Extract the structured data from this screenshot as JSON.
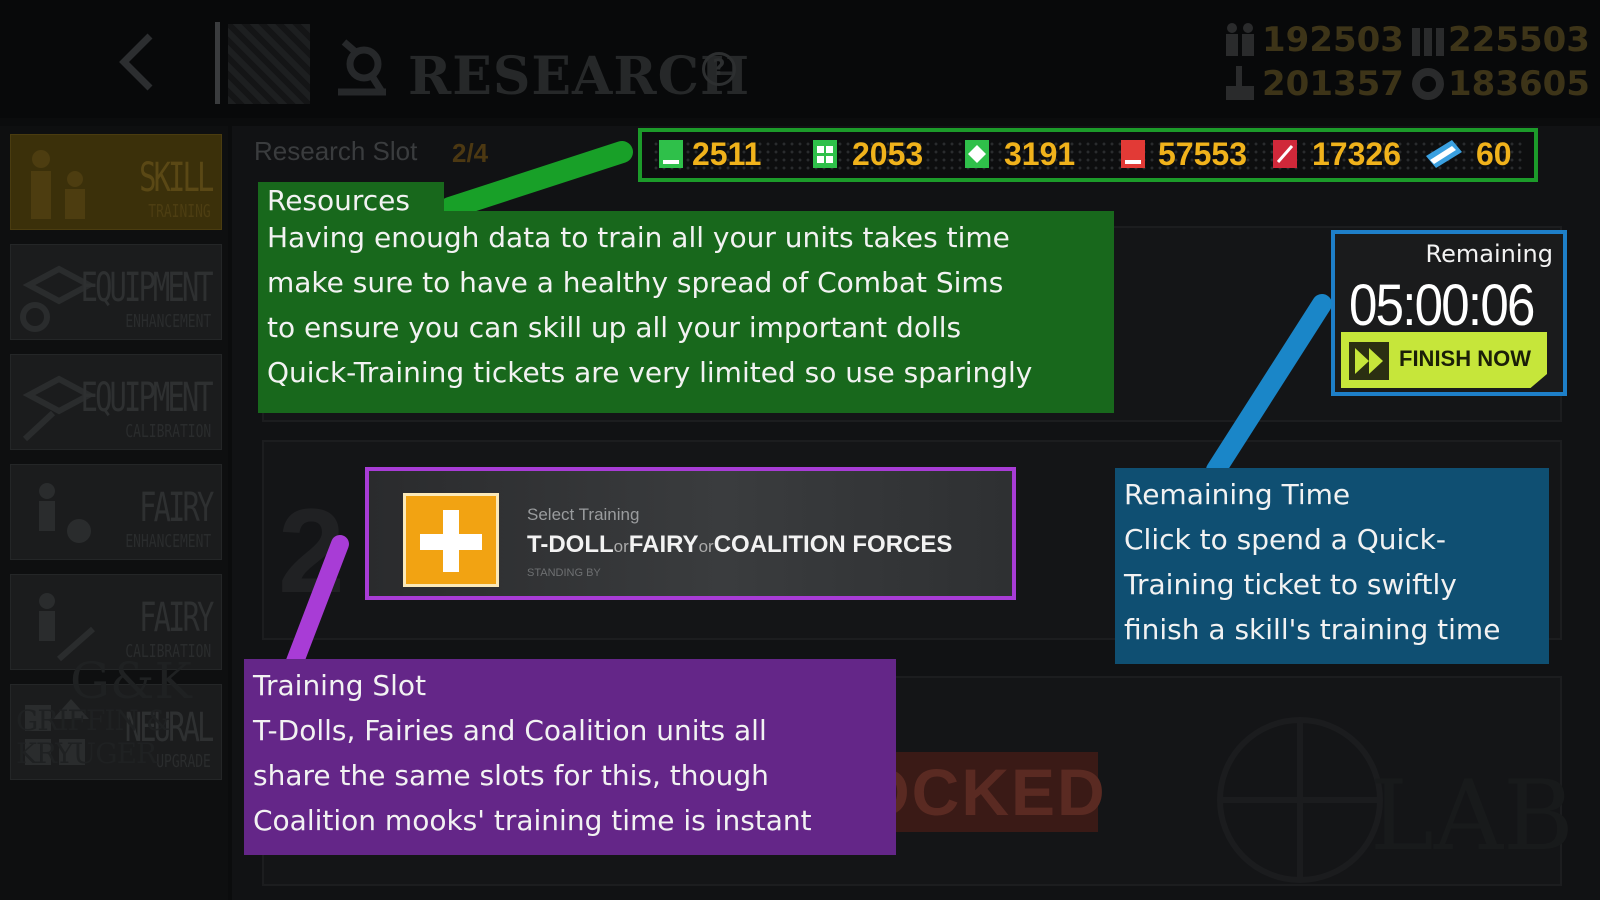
{
  "header": {
    "title": "RESEARCH",
    "help": "?",
    "stats": [
      {
        "icon": "manpower-icon",
        "value": "192503"
      },
      {
        "icon": "ammo-icon",
        "value": "225503"
      },
      {
        "icon": "rations-icon",
        "value": "201357"
      },
      {
        "icon": "parts-icon",
        "value": "183605"
      }
    ]
  },
  "sidebar": {
    "items": [
      {
        "line1": "SKILL",
        "line2": "TRAINING",
        "active": true
      },
      {
        "line1": "EQUIPMENT",
        "line2": "ENHANCEMENT"
      },
      {
        "line1": "EQUIPMENT",
        "line2": "CALIBRATION"
      },
      {
        "line1": "FAIRY",
        "line2": "ENHANCEMENT"
      },
      {
        "line1": "FAIRY",
        "line2": "CALIBRATION"
      },
      {
        "line1": "NEURAL",
        "line2": "UPGRADE"
      }
    ]
  },
  "slots": {
    "label": "Research Slot",
    "count": "2/4",
    "slot_number": "2",
    "locked": "LOCKED",
    "lab": "LAB"
  },
  "resources": [
    {
      "icon": "basic-combat-sim-icon",
      "value": "2511",
      "color": "#2fc04a"
    },
    {
      "icon": "intermediate-combat-sim-icon",
      "value": "2053",
      "color": "#2fc04a"
    },
    {
      "icon": "advanced-combat-sim-icon",
      "value": "3191",
      "color": "#2fc04a"
    },
    {
      "icon": "basic-data-icon",
      "value": "57553",
      "color": "#e23a36"
    },
    {
      "icon": "advanced-data-icon",
      "value": "17326",
      "color": "#d0283a"
    },
    {
      "icon": "quick-training-ticket-icon",
      "value": "60",
      "color": "#3aa0e0"
    }
  ],
  "select_slot": {
    "top_label": "Select Training",
    "options": [
      "T-DOLL",
      "FAIRY",
      "COALITION FORCES"
    ],
    "separator": "or",
    "status": "STANDING BY"
  },
  "timer": {
    "label": "Remaining",
    "value": "05:00:06",
    "finish_label": "FINISH NOW"
  },
  "notes": {
    "resources": {
      "title": "Resources",
      "lines": [
        "Having enough data to train all your units takes time",
        "make sure to have a healthy spread of Combat Sims",
        "to ensure you can skill up all your important dolls",
        "Quick-Training tickets are very limited so use sparingly"
      ]
    },
    "remaining": {
      "title": "Remaining Time",
      "lines": [
        "Click to spend a Quick-",
        "Training ticket to swiftly",
        "finish a skill's training time"
      ]
    },
    "training": {
      "title": "Training Slot",
      "lines": [
        "T-Dolls, Fairies and Coalition units all",
        "share the same slots for this, though",
        "Coalition mooks' training time is instant"
      ]
    }
  },
  "colors": {
    "green_note": "#18681c",
    "blue_note": "#0f4f72",
    "purple_note": "#642688",
    "resource_number": "#f0b21b",
    "finish_button": "#c6e63a"
  }
}
